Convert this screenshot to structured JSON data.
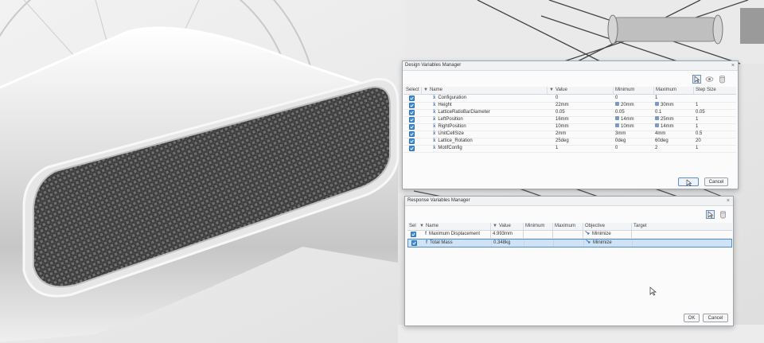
{
  "dvm": {
    "title": "Design Variables Manager",
    "columns": [
      "Select",
      "Name",
      "Value",
      "Minimum",
      "Maximum",
      "Step Size"
    ],
    "rows": [
      {
        "name": "Configuration",
        "value": "0",
        "min": "0",
        "max": "1",
        "step": "",
        "min_lock": false,
        "max_lock": false
      },
      {
        "name": "Height",
        "value": "22mm",
        "min": "20mm",
        "max": "30mm",
        "step": "1",
        "min_lock": true,
        "max_lock": true
      },
      {
        "name": "LatticeRatioBarDiameter",
        "value": "0.05",
        "min": "0.05",
        "max": "0.1",
        "step": "0.05",
        "min_lock": false,
        "max_lock": false
      },
      {
        "name": "LeftPosition",
        "value": "16mm",
        "min": "14mm",
        "max": "25mm",
        "step": "1",
        "min_lock": true,
        "max_lock": true
      },
      {
        "name": "RightPosition",
        "value": "10mm",
        "min": "10mm",
        "max": "14mm",
        "step": "1",
        "min_lock": true,
        "max_lock": true
      },
      {
        "name": "UnitCellSize",
        "value": "2mm",
        "min": "3mm",
        "max": "4mm",
        "step": "0.5",
        "min_lock": false,
        "max_lock": false
      },
      {
        "name": "Lattice_Rotation",
        "value": "25deg",
        "min": "0deg",
        "max": "60deg",
        "step": "20",
        "min_lock": false,
        "max_lock": false
      },
      {
        "name": "MotifConfig",
        "value": "1",
        "min": "0",
        "max": "2",
        "step": "1",
        "min_lock": false,
        "max_lock": false
      }
    ],
    "ok_label": "OK",
    "cancel_label": "Cancel",
    "close_glyph": "×"
  },
  "rvm": {
    "title": "Response Variables Manager",
    "columns": [
      "Sel",
      "Name",
      "Value",
      "Minimum",
      "Maximum",
      "Objective",
      "Target"
    ],
    "rows": [
      {
        "name": "Maximum Displacement",
        "value": "4.993mm",
        "min": "",
        "max": "",
        "objective": "Minimize",
        "target": "",
        "selected": false
      },
      {
        "name": "Total Mass",
        "value": "0.348kg",
        "min": "",
        "max": "",
        "objective": "Minimize",
        "target": "",
        "selected": true
      }
    ],
    "ok_label": "OK",
    "cancel_label": "Cancel",
    "close_glyph": "×"
  },
  "icons": {
    "select_tool": "select-arrow-icon",
    "visibility": "eye-icon",
    "database": "database-icon",
    "design_variable": "design-variable-icon",
    "response_variable": "response-variable-icon",
    "lock": "lock-icon",
    "minimize": "minimize-arrow-icon",
    "filter": "filter-icon"
  },
  "colors": {
    "checkbox": "#3f8fd8",
    "selection": "#cfe3f7",
    "selection_border": "#4f8fd0"
  }
}
